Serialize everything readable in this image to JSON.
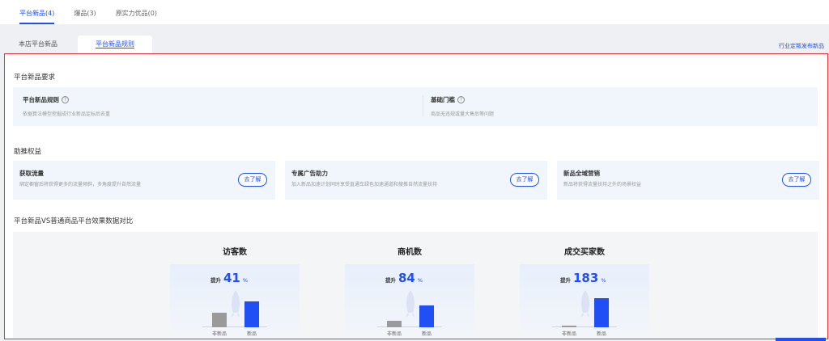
{
  "top_tabs": [
    {
      "label": "平台新品(4)",
      "active": true
    },
    {
      "label": "爆品(3)",
      "active": false
    },
    {
      "label": "原实力优品(0)",
      "active": false
    }
  ],
  "sub_tabs": [
    {
      "label": "本店平台新品"
    },
    {
      "label": "平台新品规则"
    }
  ],
  "right_link": "行业定叛发布新品",
  "requirements": {
    "title": "平台新品要求",
    "items": [
      {
        "title": "平台新品规则",
        "desc": "依据算法模型挖掘成行业新品定标后去重"
      },
      {
        "title": "基础门槛",
        "desc": "商品无违规或量大售后等问题"
      }
    ]
  },
  "benefits": {
    "title": "助推权益",
    "button_label": "去了解",
    "items": [
      {
        "title": "获取流量",
        "desc": "绑定橱窗后将获得更多的流量倾斜，多角度提升自然流量"
      },
      {
        "title": "专属广告助力",
        "desc": "加入新品加速计划同时享受直通车绿色加速通道和搜推自然流量扶持"
      },
      {
        "title": "新品全域营销",
        "desc": "新品将获得流量扶持之外的场景权益"
      }
    ]
  },
  "comparison": {
    "title": "平台新品VS普通商品平台效果数据对比",
    "lift_label": "提升",
    "pct_unit": "%",
    "old_label": "非新品",
    "new_label": "新品",
    "metrics": [
      {
        "name": "访客数",
        "lift": "41",
        "old_ratio": 0.5,
        "new_ratio": 0.9
      },
      {
        "name": "商机数",
        "lift": "84",
        "old_ratio": 0.22,
        "new_ratio": 0.75
      },
      {
        "name": "成交买家数",
        "lift": "183",
        "old_ratio": 0.05,
        "new_ratio": 1.0
      }
    ]
  },
  "colors": {
    "accent": "#1f4ff5",
    "highlight_border": "#e0343a"
  }
}
